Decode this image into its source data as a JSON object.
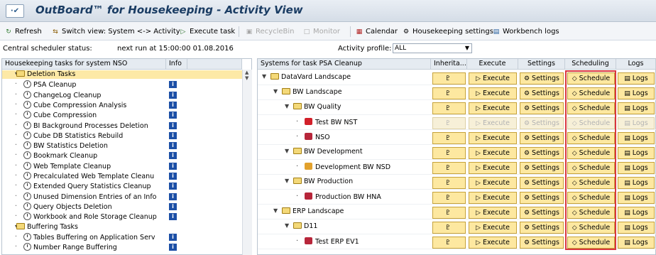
{
  "app": {
    "icon_text": "·✔",
    "title": "OutBoard™ for Housekeeping - Activity View"
  },
  "toolbar": {
    "refresh": "Refresh",
    "switch_view": "Switch view: System <-> Activity",
    "execute_task": "Execute task",
    "recycle_bin": "RecycleBin",
    "monitor": "Monitor",
    "calendar": "Calendar",
    "housekeeping_settings": "Housekeeping settings",
    "workbench_logs": "Workbench logs"
  },
  "status": {
    "label": "Central scheduler status:",
    "next_run": "next run at 15:00:00 01.08.2016",
    "profile_label": "Activity profile:",
    "profile_value": "ALL"
  },
  "left_panel": {
    "col_tasks": "Housekeeping tasks for system NSO",
    "col_info": "Info",
    "rows": [
      {
        "label": "Deletion Tasks",
        "type": "folder",
        "level": 0,
        "info": false
      },
      {
        "label": "PSA Cleanup",
        "type": "task",
        "level": 1,
        "info": true
      },
      {
        "label": "ChangeLog Cleanup",
        "type": "task",
        "level": 1,
        "info": true
      },
      {
        "label": "Cube Compression Analysis",
        "type": "task",
        "level": 1,
        "info": true
      },
      {
        "label": "Cube Compression",
        "type": "task",
        "level": 1,
        "info": true
      },
      {
        "label": "BI Background Processes Deletion",
        "type": "task",
        "level": 1,
        "info": true
      },
      {
        "label": "Cube DB Statistics Rebuild",
        "type": "task",
        "level": 1,
        "info": true
      },
      {
        "label": "BW Statistics Deletion",
        "type": "task",
        "level": 1,
        "info": true
      },
      {
        "label": "Bookmark Cleanup",
        "type": "task",
        "level": 1,
        "info": true
      },
      {
        "label": "Web Template Cleanup",
        "type": "task",
        "level": 1,
        "info": true
      },
      {
        "label": "Precalculated Web Template Cleanu",
        "type": "task",
        "level": 1,
        "info": true
      },
      {
        "label": "Extended Query Statistics Cleanup",
        "type": "task",
        "level": 1,
        "info": true
      },
      {
        "label": "Unused Dimension Entries of an Info",
        "type": "task",
        "level": 1,
        "info": true
      },
      {
        "label": "Query Objects Deletion",
        "type": "task",
        "level": 1,
        "info": true
      },
      {
        "label": "Workbook and Role Storage Cleanup",
        "type": "task",
        "level": 1,
        "info": true
      },
      {
        "label": "Buffering Tasks",
        "type": "folder",
        "level": 0,
        "info": false
      },
      {
        "label": "Tables Buffering on Application Serv",
        "type": "task",
        "level": 1,
        "info": true
      },
      {
        "label": "Number Range Buffering",
        "type": "task",
        "level": 1,
        "info": true
      }
    ]
  },
  "right_panel": {
    "col_systems": "Systems for task PSA Cleanup",
    "col_inherit": "Inherita...",
    "col_execute": "Execute",
    "col_settings": "Settings",
    "col_scheduling": "Scheduling",
    "col_logs": "Logs",
    "btn_execute": "Execute",
    "btn_settings": "Settings",
    "btn_schedule": "Schedule",
    "btn_logs": "Logs",
    "rows": [
      {
        "label": "DataVard Landscape",
        "type": "folder",
        "level": 0,
        "disabled": false
      },
      {
        "label": "BW Landscape",
        "type": "folder",
        "level": 1,
        "disabled": false
      },
      {
        "label": "BW Quality",
        "type": "folder",
        "level": 2,
        "disabled": false
      },
      {
        "label": "Test BW NST",
        "type": "system-red",
        "level": 3,
        "disabled": true
      },
      {
        "label": "NSO",
        "type": "system",
        "level": 3,
        "disabled": false
      },
      {
        "label": "BW Development",
        "type": "folder",
        "level": 2,
        "disabled": false
      },
      {
        "label": "Development BW NSD",
        "type": "system-dev",
        "level": 3,
        "disabled": false
      },
      {
        "label": "BW Production",
        "type": "folder",
        "level": 2,
        "disabled": false
      },
      {
        "label": "Production BW HNA",
        "type": "system",
        "level": 3,
        "disabled": false
      },
      {
        "label": "ERP Landscape",
        "type": "folder",
        "level": 1,
        "disabled": false
      },
      {
        "label": "D11",
        "type": "folder",
        "level": 2,
        "disabled": false
      },
      {
        "label": "Test ERP EV1",
        "type": "system",
        "level": 3,
        "disabled": false
      }
    ]
  }
}
